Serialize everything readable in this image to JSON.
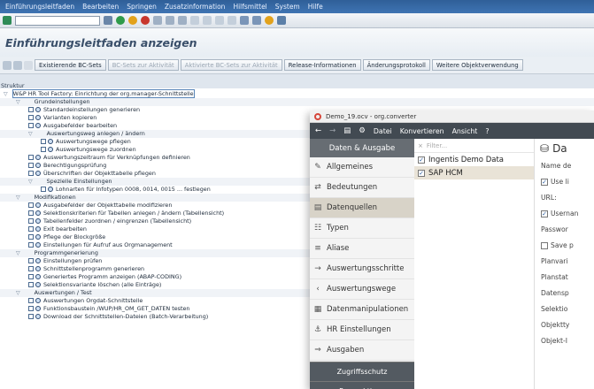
{
  "menu": [
    "Einführungsleitfaden",
    "Bearbeiten",
    "Springen",
    "Zusatzinformation",
    "Hilfsmittel",
    "System",
    "Hilfe"
  ],
  "title": "Einführungsleitfaden anzeigen",
  "appbar": {
    "buttons": [
      {
        "label": "Existierende BC-Sets",
        "disabled": false
      },
      {
        "label": "BC-Sets zur Aktivität",
        "disabled": true
      },
      {
        "label": "Aktivierte BC-Sets zur Aktivität",
        "disabled": true
      },
      {
        "label": "Release-Informationen",
        "disabled": false
      },
      {
        "label": "Änderungsprotokoll",
        "disabled": false
      },
      {
        "label": "Weitere Objektverwendung",
        "disabled": false
      }
    ]
  },
  "struct_label": "Struktur",
  "tree": [
    {
      "level": 0,
      "kind": "root",
      "text": "W&P HR Tool Factory: Einrichtung der org.manager-Schnittstelle"
    },
    {
      "level": 1,
      "kind": "folder",
      "text": "Grundeinstellungen"
    },
    {
      "level": 2,
      "kind": "exec",
      "text": "Standardeinstellungen generieren"
    },
    {
      "level": 2,
      "kind": "exec",
      "text": "Varianten kopieren"
    },
    {
      "level": 2,
      "kind": "exec",
      "text": "Ausgabefelder bearbeiten"
    },
    {
      "level": 2,
      "kind": "folder",
      "text": "Auswertungsweg anlegen / ändern"
    },
    {
      "level": 3,
      "kind": "exec",
      "text": "Auswertungswege pflegen"
    },
    {
      "level": 3,
      "kind": "exec",
      "text": "Auswertungswege zuordnen"
    },
    {
      "level": 2,
      "kind": "exec",
      "text": "Auswertungszeitraum für Verknüpfungen definieren"
    },
    {
      "level": 2,
      "kind": "exec",
      "text": "Berechtigungsprüfung"
    },
    {
      "level": 2,
      "kind": "exec",
      "text": "Überschriften der Objekttabelle pflegen"
    },
    {
      "level": 2,
      "kind": "folder",
      "text": "Spezielle Einstellungen"
    },
    {
      "level": 3,
      "kind": "exec",
      "text": "Lohnarten für Infotypen 0008, 0014, 0015 ... festlegen"
    },
    {
      "level": 1,
      "kind": "folder",
      "text": "Modifikationen"
    },
    {
      "level": 2,
      "kind": "exec",
      "text": "Ausgabefelder der Objekttabelle modifizieren"
    },
    {
      "level": 2,
      "kind": "exec",
      "text": "Selektionskriterien für Tabellen anlegen / ändern (Tabellensicht)"
    },
    {
      "level": 2,
      "kind": "exec",
      "text": "Tabellenfelder zuordnen / eingrenzen (Tabellensicht)"
    },
    {
      "level": 2,
      "kind": "exec",
      "text": "Exit bearbeiten"
    },
    {
      "level": 2,
      "kind": "exec",
      "text": "Pflege der Blockgröße"
    },
    {
      "level": 2,
      "kind": "exec",
      "text": "Einstellungen für Aufruf aus Orgmanagement"
    },
    {
      "level": 1,
      "kind": "folder",
      "text": "Programmgenerierung"
    },
    {
      "level": 2,
      "kind": "exec",
      "text": "Einstellungen prüfen"
    },
    {
      "level": 2,
      "kind": "exec",
      "text": "Schnittstellenprogramm generieren"
    },
    {
      "level": 2,
      "kind": "exec",
      "text": "Generiertes Programm anzeigen (ABAP-CODING)"
    },
    {
      "level": 2,
      "kind": "exec",
      "text": "Selektionsvariante löschen (alle Einträge)"
    },
    {
      "level": 1,
      "kind": "folder",
      "text": "Auswertungen / Test"
    },
    {
      "level": 2,
      "kind": "exec",
      "text": "Auswertungen Orgdat-Schnittstelle"
    },
    {
      "level": 2,
      "kind": "exec",
      "text": "Funktionsbaustein /WUP/HR_OM_GET_DATEN testen"
    },
    {
      "level": 2,
      "kind": "exec",
      "text": "Download der Schnittstellen-Dateien (Batch-Verarbeitung)"
    }
  ],
  "app": {
    "window_title": "Demo_19.ocv - org.converter",
    "menu": [
      "Datei",
      "Konvertieren",
      "Ansicht",
      "?"
    ],
    "nav_header": "Daten & Ausgabe",
    "nav_items": [
      {
        "label": "Allgemeines",
        "icon": "pencil-icon"
      },
      {
        "label": "Bedeutungen",
        "icon": "translate-icon"
      },
      {
        "label": "Datenquellen",
        "icon": "database-icon",
        "active": true
      },
      {
        "label": "Typen",
        "icon": "types-icon"
      },
      {
        "label": "Aliase",
        "icon": "alias-icon"
      },
      {
        "label": "Auswertungsschritte",
        "icon": "steps-icon"
      },
      {
        "label": "Auswertungswege",
        "icon": "share-icon"
      },
      {
        "label": "Datenmanipulationen",
        "icon": "calculator-icon"
      },
      {
        "label": "HR Einstellungen",
        "icon": "hr-icon"
      },
      {
        "label": "Ausgaben",
        "icon": "output-icon"
      }
    ],
    "nav_footers": [
      "Zugriffsschutz",
      "Perspektiven"
    ],
    "filter_placeholder": "Filter...",
    "sources": [
      {
        "label": "Ingentis Demo Data",
        "checked": true,
        "selected": false
      },
      {
        "label": "SAP HCM",
        "checked": true,
        "selected": true
      }
    ],
    "detail_title": "Da",
    "detail_labels": [
      "Name de",
      "Use li",
      "URL:",
      "Usernan",
      "Passwor",
      "Save p",
      "Planvari",
      "Planstat",
      "Datensp",
      "Selektio",
      "Objektty",
      "Objekt-I"
    ]
  }
}
